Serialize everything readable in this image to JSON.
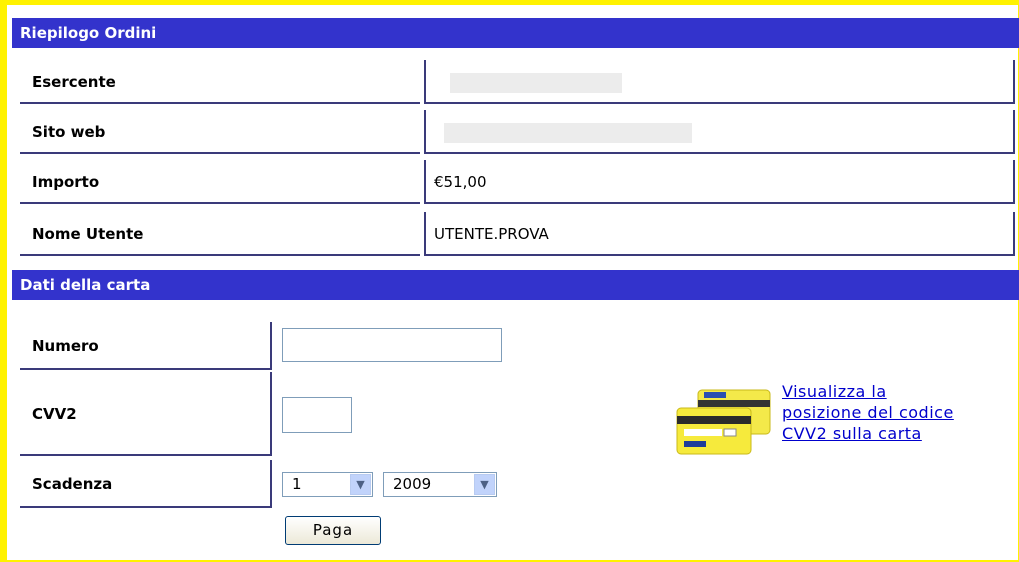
{
  "riepilogo": {
    "header": "Riepilogo Ordini",
    "rows": [
      {
        "label": "Esercente",
        "value": ""
      },
      {
        "label": "Sito web",
        "value": ""
      },
      {
        "label": "Importo",
        "value": "€51,00"
      },
      {
        "label": "Nome Utente",
        "value": "UTENTE.PROVA"
      }
    ]
  },
  "carta": {
    "header": "Dati della carta",
    "numero_label": "Numero",
    "numero_value": "",
    "cvv2_label": "CVV2",
    "cvv2_value": "",
    "scadenza_label": "Scadenza",
    "month_selected": "1",
    "year_selected": "2009",
    "pay_button": "Paga",
    "cvv_link": [
      "Visualizza la",
      "posizione del codice",
      "CVV2 sulla carta"
    ],
    "card_brand": "postepay"
  },
  "colors": {
    "header_bg": "#3333cc",
    "frame": "#fff200",
    "link": "#0000cc"
  }
}
